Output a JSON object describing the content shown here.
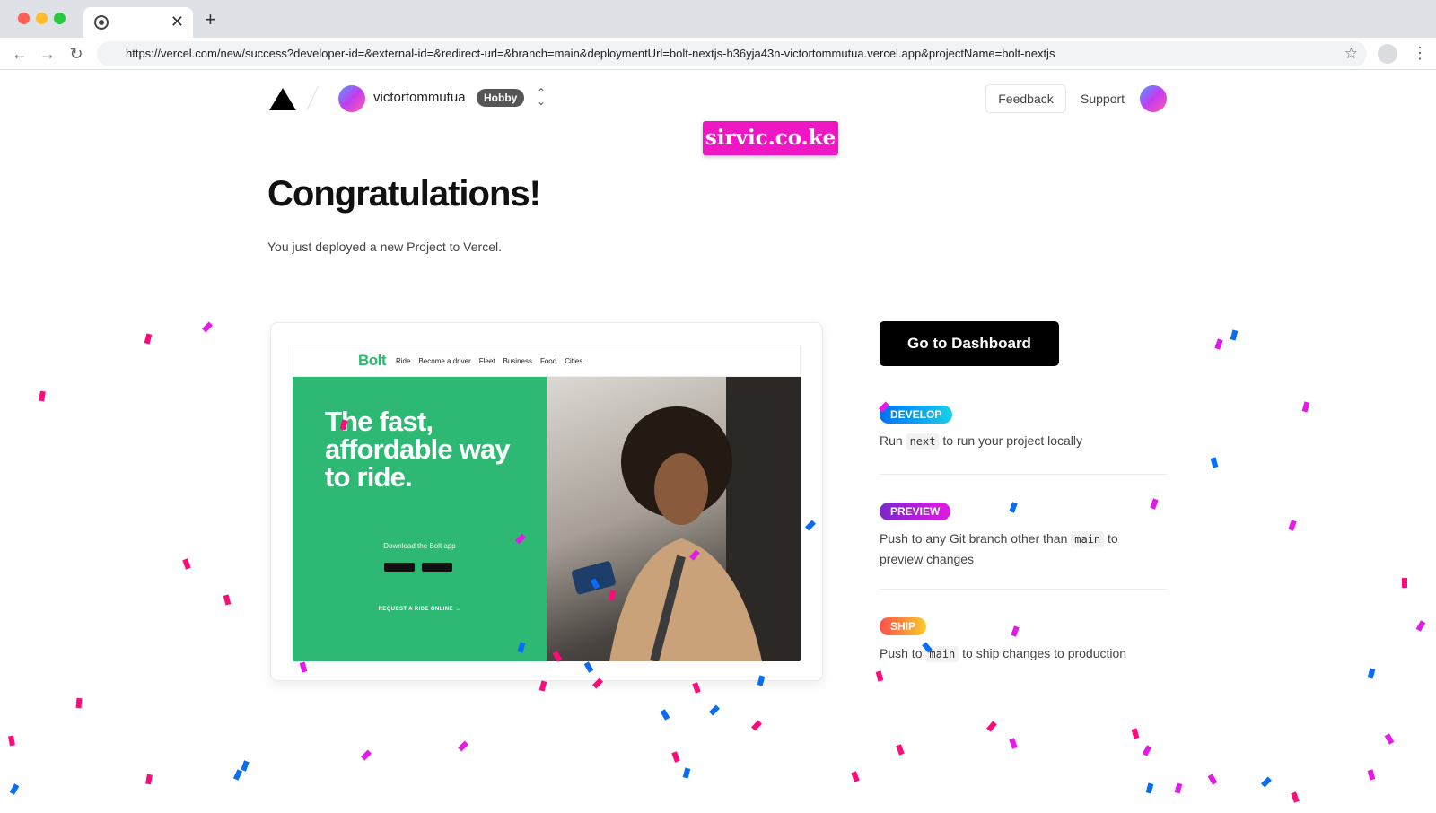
{
  "browser": {
    "url": "https://vercel.com/new/success?developer-id=&external-id=&redirect-url=&branch=main&deploymentUrl=bolt-nextjs-h36yja43n-victortommutua.vercel.app&projectName=bolt-nextjs",
    "tab_close": "✕",
    "new_tab": "+"
  },
  "header": {
    "team_name": "victortommutua",
    "plan": "Hobby",
    "feedback": "Feedback",
    "support": "Support"
  },
  "watermark": "sirvic.co.ke",
  "main": {
    "title": "Congratulations!",
    "subtitle": "You just deployed a new Project to Vercel.",
    "dashboard_button": "Go to Dashboard"
  },
  "preview": {
    "logo": "Bolt",
    "nav": [
      "Ride",
      "Become a driver",
      "Fleet",
      "Business",
      "Food",
      "Cities"
    ],
    "hero": "The fast, affordable way to ride.",
    "download": "Download the Bolt app",
    "cta": "REQUEST A RIDE ONLINE →"
  },
  "steps": [
    {
      "badge": "DEVELOP",
      "pre": "Run ",
      "code": "next",
      "post": " to run your project locally"
    },
    {
      "badge": "PREVIEW",
      "pre": "Push to any Git branch other than ",
      "code": "main",
      "post": " to preview changes"
    },
    {
      "badge": "SHIP",
      "pre": "Push to ",
      "code": "main",
      "post": " to ship changes to production"
    }
  ],
  "colors": {
    "develop": "#0a84ff",
    "preview": "#a020f0",
    "ship": "#ff5b5b",
    "confetti_pink": "#ff0a7a",
    "confetti_magenta": "#e41ae6",
    "confetti_blue": "#0a6cf0"
  }
}
